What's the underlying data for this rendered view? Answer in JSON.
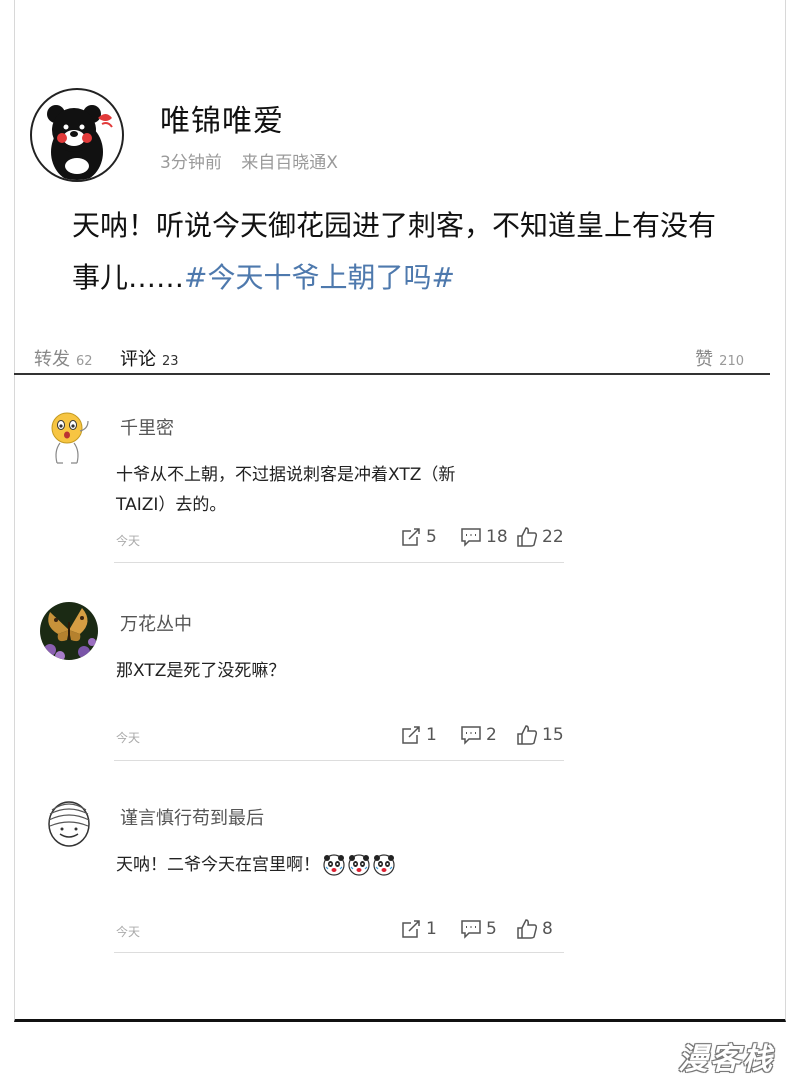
{
  "post": {
    "author": "唯锦唯爱",
    "time": "3分钟前",
    "source": "来自百晓通X",
    "text": "天呐！听说今天御花园进了刺客，不知道皇上有没有事儿……",
    "hashtag": "#今天十爷上朝了吗#"
  },
  "tabs": {
    "repost": {
      "label": "转发",
      "count": "62"
    },
    "comment": {
      "label": "评论",
      "count": "23"
    },
    "like": {
      "label": "赞",
      "count": "210"
    }
  },
  "comments": [
    {
      "name": "千里密",
      "text": "十爷从不上朝，不过据说刺客是冲着XTZ（新TAIZI）去的。",
      "time": "今天",
      "reposts": "5",
      "replies": "18",
      "likes": "22",
      "avatar_icon": "surprised-emoji-icon"
    },
    {
      "name": "万花丛中",
      "text": "那XTZ是死了没死嘛？",
      "time": "今天",
      "reposts": "1",
      "replies": "2",
      "likes": "15",
      "avatar_icon": "butterfly-flower-icon"
    },
    {
      "name": "谨言慎行苟到最后",
      "text": "天呐！二爷今天在宫里啊！",
      "time": "今天",
      "reposts": "1",
      "replies": "5",
      "likes": "8",
      "avatar_icon": "bandaged-face-icon",
      "emojis": [
        "panda-shock-icon",
        "panda-shock-icon",
        "panda-shock-icon"
      ]
    }
  ],
  "watermark": {
    "text": "漫客栈"
  },
  "colors": {
    "hashtag": "#4e79ad",
    "meta": "#9a9a9a"
  }
}
